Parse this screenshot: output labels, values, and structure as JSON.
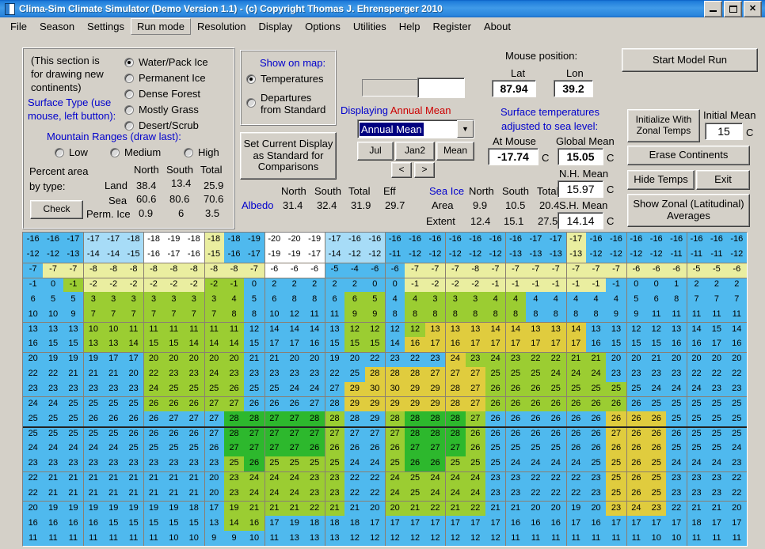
{
  "window": {
    "title": "Clima-Sim Climate Simulator (Demo Version 1.1)   -   (c) Copyright Thomas J. Ehrensperger 2010",
    "icon": "document-icon",
    "minimize": "_",
    "maximize": "□",
    "close": "✕"
  },
  "menu": {
    "items": [
      {
        "label": "File",
        "selected": false
      },
      {
        "label": "Season",
        "selected": false
      },
      {
        "label": "Settings",
        "selected": false
      },
      {
        "label": "Run mode",
        "selected": true
      },
      {
        "label": "Resolution",
        "selected": false
      },
      {
        "label": "Display",
        "selected": false
      },
      {
        "label": "Options",
        "selected": false
      },
      {
        "label": "Utilities",
        "selected": false
      },
      {
        "label": "Help",
        "selected": false
      },
      {
        "label": "Register",
        "selected": false
      },
      {
        "label": "About",
        "selected": false
      }
    ]
  },
  "draw_panel": {
    "note_line1": "(This section is",
    "note_line2": "for drawing new",
    "note_line3": "continents)",
    "surface_type_label_1": "Surface Type (use",
    "surface_type_label_2": "mouse, left button):",
    "surface_options": [
      {
        "label": "Water/Pack Ice",
        "selected": true
      },
      {
        "label": "Permanent Ice",
        "selected": false
      },
      {
        "label": "Dense Forest",
        "selected": false
      },
      {
        "label": "Mostly Grass",
        "selected": false
      },
      {
        "label": "Desert/Scrub",
        "selected": false
      }
    ],
    "mountain_label": "Mountain Ranges (draw last):",
    "mountain_options": [
      {
        "label": "Low",
        "selected": false
      },
      {
        "label": "Medium",
        "selected": false
      },
      {
        "label": "High",
        "selected": false
      }
    ],
    "percent_label_1": "Percent area",
    "percent_label_2": "by type:",
    "check_button": "Check",
    "table": {
      "headers": [
        "North",
        "South",
        "Total"
      ],
      "rows": [
        {
          "name": "Land",
          "north": "38.4",
          "south": "13.4",
          "total": "25.9"
        },
        {
          "name": "Sea",
          "north": "60.6",
          "south": "80.6",
          "total": "70.6"
        },
        {
          "name": "Perm. Ice",
          "north": "0.9",
          "south": "6",
          "total": "3.5"
        }
      ]
    }
  },
  "show_on_map": {
    "title": "Show on map:",
    "options": [
      {
        "label": "Temperatures",
        "selected": true
      },
      {
        "label": "Departures\nfrom Standard",
        "line1": "Departures",
        "line2": "from Standard",
        "selected": false
      }
    ],
    "set_standard_button_l1": "Set Current Display",
    "set_standard_button_l2": "as Standard for",
    "set_standard_button_l3": "Comparisons"
  },
  "display_panel": {
    "displaying_prefix": "Displaying",
    "displaying_value": "Annual Mean",
    "select_value": "Annual Mean",
    "dropdown_arrow": "▼",
    "progress_value": "",
    "buttons": [
      "Jul",
      "Jan2",
      "Mean"
    ],
    "nav_prev": "<",
    "nav_next": ">"
  },
  "albedo": {
    "row_label": "Albedo",
    "headers": [
      "North",
      "South",
      "Total",
      "Eff"
    ],
    "values": [
      "31.4",
      "32.4",
      "31.9",
      "29.7"
    ]
  },
  "sea_ice": {
    "title": "Sea Ice",
    "headers": [
      "North",
      "South",
      "Total"
    ],
    "rows": [
      {
        "name": "Area",
        "north": "9.9",
        "south": "10.5",
        "total": "20.4"
      },
      {
        "name": "Extent",
        "north": "12.4",
        "south": "15.1",
        "total": "27.5"
      }
    ]
  },
  "mouse_position": {
    "title": "Mouse position:",
    "lat_label": "Lat",
    "lon_label": "Lon",
    "lat_value": "87.94",
    "lon_value": "39.2"
  },
  "temperatures": {
    "note_line1": "Surface temperatures",
    "note_line2": "adjusted to sea level:",
    "at_mouse_label": "At Mouse",
    "at_mouse_value": "-17.74",
    "at_mouse_unit": "C",
    "global_mean_label": "Global Mean",
    "global_mean_value": "15.05",
    "global_mean_unit": "C",
    "nh_mean_label": "N.H. Mean",
    "nh_mean_value": "15.97",
    "nh_mean_unit": "C",
    "sh_mean_label": "S.H. Mean",
    "sh_mean_value": "14.14",
    "sh_mean_unit": "C"
  },
  "actions": {
    "start_model_run": "Start Model Run",
    "initialize_l1": "Initialize  With",
    "initialize_l2": "Zonal Temps",
    "initial_mean_label": "Initial Mean",
    "initial_mean_value": "15",
    "initial_mean_unit": "C",
    "erase_continents": "Erase Continents",
    "hide_temps": "Hide Temps",
    "exit": "Exit",
    "show_zonal_l1": "Show Zonal (Latitudinal)",
    "show_zonal_l2": "Averages"
  },
  "map": {
    "palette": {
      "water": "#4fb9ee",
      "pale_blue": "#a7dcf7",
      "white": "#ffffff",
      "pale_yellow": "#eaeea0",
      "grass": "#9bcd32",
      "forest": "#2db82d",
      "desert": "#e0cc3e",
      "olive": "#b8c93c"
    },
    "cols": 36,
    "rows": 25,
    "values": [
      [
        -16,
        -16,
        -17,
        -17,
        -17,
        -18,
        -18,
        -19,
        -18,
        -18,
        -18,
        -19,
        -20,
        -20,
        -19,
        -17,
        -16,
        -16,
        -16,
        -16,
        -16,
        -16,
        -16,
        -16,
        -16,
        -17,
        -17,
        -17,
        -16,
        -16,
        -16,
        -16,
        -16,
        -16,
        -16,
        -16
      ],
      [
        -12,
        -12,
        -13,
        -14,
        -14,
        -15,
        -16,
        -17,
        -16,
        -15,
        -16,
        -17,
        -19,
        -19,
        -17,
        -14,
        -12,
        -12,
        -11,
        -12,
        -12,
        -12,
        -12,
        -12,
        -13,
        -13,
        -13,
        -13,
        -12,
        -12,
        -12,
        -12,
        -11,
        -11,
        -11,
        -12
      ],
      [
        -7,
        -7,
        -7,
        -8,
        -8,
        -8,
        -8,
        -8,
        -8,
        -8,
        -8,
        -7,
        -6,
        -6,
        -6,
        -5,
        -4,
        -6,
        -6,
        -7,
        -7,
        -7,
        -8,
        -7,
        -7,
        -7,
        -7,
        -7,
        -7,
        -7,
        -6,
        -6,
        -6,
        -5,
        -5,
        -6
      ],
      [
        -1,
        0,
        -1,
        -2,
        -2,
        -2,
        -2,
        -2,
        -2,
        -2,
        -1,
        0,
        2,
        2,
        2,
        2,
        2,
        0,
        0,
        -1,
        -2,
        -2,
        -2,
        -1,
        -1,
        -1,
        -1,
        -1,
        -1,
        -1,
        0,
        0,
        1,
        2,
        2,
        2
      ],
      [
        6,
        5,
        5,
        3,
        3,
        3,
        3,
        3,
        3,
        3,
        4,
        5,
        6,
        8,
        8,
        6,
        6,
        5,
        4,
        4,
        3,
        3,
        3,
        4,
        4,
        4,
        4,
        4,
        4,
        4,
        5,
        6,
        8,
        7,
        7,
        7
      ],
      [
        10,
        10,
        9,
        7,
        7,
        7,
        7,
        7,
        7,
        7,
        8,
        8,
        10,
        12,
        11,
        11,
        9,
        9,
        8,
        8,
        8,
        8,
        8,
        8,
        8,
        8,
        8,
        8,
        8,
        9,
        9,
        11,
        11,
        11,
        11,
        11
      ],
      [
        13,
        13,
        13,
        10,
        10,
        11,
        11,
        11,
        11,
        11,
        11,
        12,
        14,
        14,
        14,
        13,
        12,
        12,
        12,
        12,
        13,
        13,
        13,
        14,
        14,
        13,
        13,
        14,
        13,
        13,
        12,
        12,
        13,
        14,
        15,
        14
      ],
      [
        16,
        15,
        15,
        13,
        13,
        14,
        15,
        15,
        14,
        14,
        14,
        15,
        17,
        17,
        16,
        15,
        15,
        15,
        14,
        16,
        17,
        16,
        17,
        17,
        17,
        17,
        17,
        17,
        16,
        15,
        15,
        15,
        16,
        16,
        17,
        16
      ],
      [
        20,
        19,
        19,
        19,
        17,
        17,
        20,
        20,
        20,
        20,
        20,
        21,
        21,
        20,
        20,
        19,
        20,
        22,
        23,
        22,
        23,
        24,
        23,
        24,
        23,
        22,
        22,
        21,
        21,
        20,
        20,
        21,
        20,
        20,
        20,
        20
      ],
      [
        22,
        22,
        21,
        21,
        21,
        20,
        22,
        23,
        23,
        24,
        23,
        23,
        23,
        23,
        23,
        22,
        25,
        28,
        28,
        28,
        27,
        27,
        27,
        25,
        25,
        25,
        24,
        24,
        24,
        23,
        23,
        23,
        23,
        22,
        22,
        22
      ],
      [
        23,
        23,
        23,
        23,
        23,
        23,
        24,
        25,
        25,
        25,
        26,
        25,
        25,
        24,
        24,
        27,
        29,
        30,
        30,
        29,
        29,
        28,
        27,
        26,
        26,
        26,
        25,
        25,
        25,
        25,
        25,
        24,
        24,
        24,
        23,
        23
      ],
      [
        24,
        24,
        25,
        25,
        25,
        25,
        26,
        26,
        26,
        27,
        27,
        26,
        26,
        26,
        27,
        28,
        29,
        29,
        29,
        29,
        29,
        28,
        27,
        26,
        26,
        26,
        26,
        26,
        26,
        26,
        26,
        25,
        25,
        25,
        25,
        25
      ],
      [
        25,
        25,
        25,
        26,
        26,
        26,
        26,
        27,
        27,
        27,
        28,
        28,
        27,
        27,
        28,
        28,
        28,
        29,
        28,
        28,
        28,
        28,
        27,
        26,
        26,
        26,
        26,
        26,
        26,
        26,
        26,
        26,
        25,
        25,
        25,
        25
      ],
      [
        25,
        25,
        25,
        25,
        25,
        26,
        26,
        26,
        26,
        27,
        28,
        27,
        27,
        27,
        27,
        27,
        27,
        27,
        27,
        28,
        28,
        28,
        26,
        26,
        26,
        26,
        26,
        26,
        26,
        27,
        26,
        26,
        26,
        25,
        25,
        25
      ],
      [
        24,
        24,
        24,
        24,
        24,
        25,
        25,
        25,
        25,
        26,
        27,
        27,
        27,
        27,
        26,
        26,
        26,
        26,
        26,
        27,
        27,
        27,
        26,
        25,
        25,
        25,
        25,
        26,
        26,
        26,
        26,
        26,
        25,
        25,
        25,
        24
      ],
      [
        23,
        23,
        23,
        23,
        23,
        23,
        23,
        23,
        23,
        23,
        25,
        26,
        25,
        25,
        25,
        25,
        24,
        24,
        25,
        26,
        26,
        25,
        25,
        25,
        24,
        24,
        24,
        24,
        25,
        25,
        26,
        25,
        24,
        24,
        24,
        23
      ],
      [
        22,
        21,
        21,
        21,
        21,
        21,
        21,
        21,
        21,
        20,
        23,
        24,
        24,
        24,
        23,
        23,
        22,
        22,
        24,
        25,
        24,
        24,
        24,
        23,
        23,
        22,
        22,
        22,
        23,
        25,
        26,
        25,
        23,
        23,
        23,
        22
      ],
      [
        22,
        21,
        21,
        21,
        21,
        21,
        21,
        21,
        21,
        20,
        23,
        24,
        24,
        24,
        23,
        23,
        22,
        22,
        24,
        25,
        24,
        24,
        24,
        23,
        23,
        22,
        22,
        22,
        23,
        25,
        26,
        25,
        23,
        23,
        23,
        22
      ],
      [
        20,
        19,
        19,
        19,
        19,
        19,
        19,
        19,
        18,
        17,
        19,
        21,
        21,
        21,
        22,
        21,
        21,
        20,
        20,
        21,
        22,
        21,
        22,
        21,
        21,
        20,
        20,
        19,
        20,
        23,
        24,
        23,
        22,
        21,
        21,
        20
      ],
      [
        16,
        16,
        16,
        16,
        15,
        15,
        15,
        15,
        15,
        13,
        14,
        16,
        17,
        19,
        18,
        18,
        18,
        17,
        17,
        17,
        17,
        17,
        17,
        17,
        16,
        16,
        16,
        17,
        16,
        17,
        17,
        17,
        17,
        18,
        17,
        17
      ],
      [
        11,
        11,
        11,
        11,
        11,
        11,
        11,
        10,
        10,
        9,
        9,
        10,
        11,
        13,
        13,
        13,
        12,
        12,
        12,
        12,
        12,
        12,
        12,
        12,
        11,
        11,
        11,
        11,
        11,
        11,
        11,
        10,
        10,
        11,
        11,
        11
      ]
    ]
  }
}
